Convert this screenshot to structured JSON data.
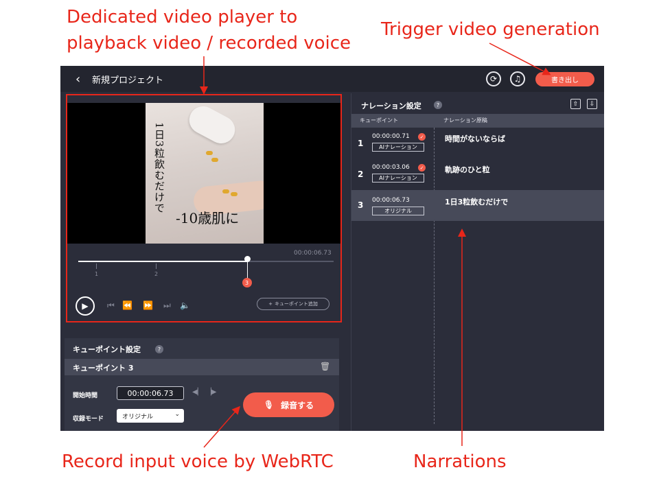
{
  "annotations": {
    "video_player_line1": "Dedicated video player to",
    "video_player_line2": "playback video / recorded voice",
    "trigger": "Trigger video generation",
    "record": "Record input voice by WebRTC",
    "narrations": "Narrations"
  },
  "header": {
    "back_icon": "chevron-left-icon",
    "title": "新規プロジェクト",
    "refresh_icon": "refresh-icon",
    "music_icon": "music-icon",
    "export_label": "書き出し"
  },
  "video": {
    "caption_vertical": "1日3粒飲むだけで",
    "caption_horizontal": "-10歳肌に",
    "current_time": "00:00:06.73",
    "progress": 0.66,
    "tick_labels": [
      "1",
      "2"
    ],
    "cue_badge": "3",
    "add_cue_label": "キューポイント追加"
  },
  "cue_settings": {
    "title": "キューポイント設定",
    "help": "?",
    "selected_label": "キューポイント 3",
    "start_time_label": "開始時間",
    "start_time_value": "00:00:06.73",
    "mode_label": "収録モード",
    "mode_value": "オリジナル",
    "record_label": "録音する"
  },
  "narration": {
    "title": "ナレーション設定",
    "help": "?",
    "col_cue": "キューポイント",
    "col_script": "ナレーション原稿",
    "rows": [
      {
        "num": "1",
        "time": "00:00:00.71",
        "tag": "AIナレーション",
        "text": "時間がないならば",
        "checked": true
      },
      {
        "num": "2",
        "time": "00:00:03.06",
        "tag": "AIナレーション",
        "text": "軌跡のひと粒",
        "checked": true
      },
      {
        "num": "3",
        "time": "00:00:06.73",
        "tag": "オリジナル",
        "text": "1日3粒飲むだけで",
        "checked": false
      }
    ]
  },
  "colors": {
    "accent": "#f25c4b",
    "annotation": "#e8261a",
    "app_bg": "#2b2d3a"
  }
}
